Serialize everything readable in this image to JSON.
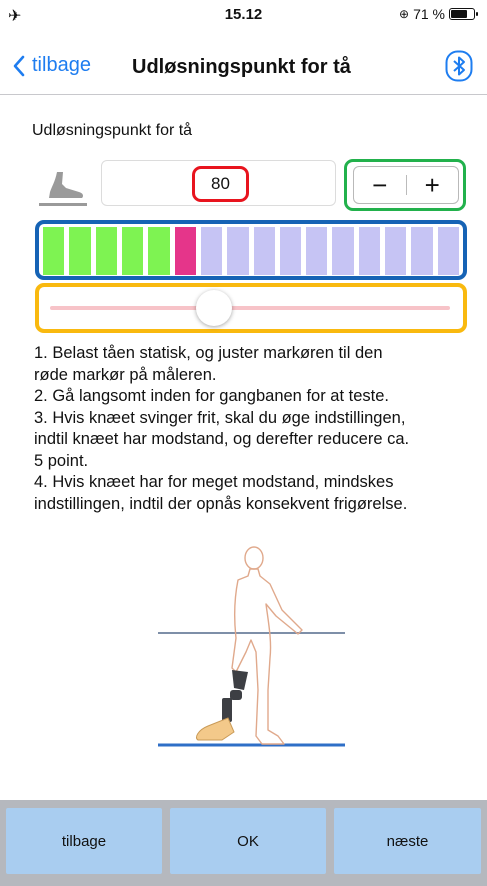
{
  "status": {
    "time": "15.12",
    "battery": "71 %"
  },
  "nav": {
    "back_label": "tilbage",
    "title": "Udløsningspunkt for tå"
  },
  "setting": {
    "label": "Udløsningspunkt for tå",
    "value": "80",
    "decrement": "−",
    "increment": "+",
    "slider_fraction": 0.41
  },
  "gauge": {
    "segments": [
      "green",
      "green",
      "green",
      "green",
      "green",
      "pink",
      "lav",
      "lav",
      "lav",
      "lav",
      "lav",
      "lav",
      "lav",
      "lav",
      "lav",
      "lav"
    ],
    "colors": {
      "green": "#7ef352",
      "pink": "#e5358a",
      "lav": "#c6c4f4"
    }
  },
  "colors": {
    "accent": "#1e7df0",
    "red_highlight": "#e8141e",
    "green_highlight": "#22b14c",
    "blue_highlight": "#1663b5",
    "yellow_highlight": "#f9b90f",
    "button_bg": "#a9cdf0"
  },
  "icons": {
    "back": "chevron-left-icon",
    "bluetooth": "bluetooth-icon",
    "foot": "foot-icon",
    "airplane": "airplane-icon"
  },
  "instructions": [
    "1. Belast tåen statisk, og juster markøren til den",
    "røde markør på måleren.",
    "2. Gå langsomt inden for gangbanen for at teste.",
    "3. Hvis knæet svinger frit, skal du øge indstillingen,",
    "indtil knæet har modstand, og derefter reducere ca.",
    "5 point.",
    "4. Hvis knæet har for meget modstand, mindskes",
    "indstillingen, indtil der opnås konsekvent frigørelse."
  ],
  "footer": {
    "back": "tilbage",
    "ok": "OK",
    "next": "næste"
  }
}
